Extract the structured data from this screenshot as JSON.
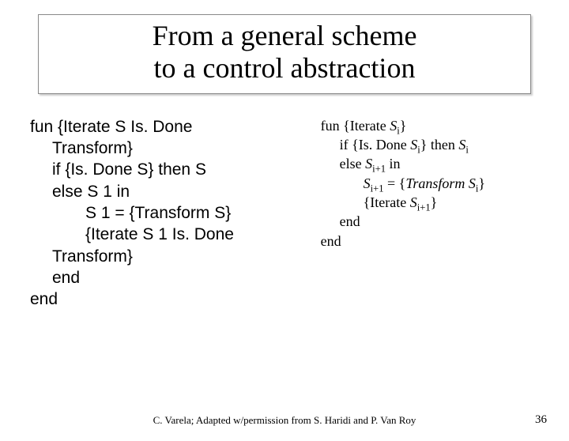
{
  "title_line1": "From a general scheme",
  "title_line2": "to a control abstraction",
  "left": {
    "l1": "fun {Iterate S Is. Done",
    "l2": "Transform}",
    "l3": "if {Is. Done S} then S",
    "l4": "else S 1 in",
    "l5": "S 1 = {Transform S}",
    "l6": "{Iterate S 1 Is. Done",
    "l7": "Transform}",
    "l8": "end",
    "l9": "end"
  },
  "right": {
    "r1a": "fun {Iterate ",
    "r1b": "S",
    "r1c": "i",
    "r1d": "}",
    "r2a": "if {Is. Done ",
    "r2b": "S",
    "r2c": "i",
    "r2d": "} then ",
    "r2e": "S",
    "r2f": "i",
    "r3a": "else ",
    "r3b": "S",
    "r3c": "i+1",
    "r3d": " in",
    "r4a": "S",
    "r4b": "i+1",
    "r4c": " = {",
    "r4d": "Transform ",
    "r4e": "S",
    "r4f": "i",
    "r4g": "}",
    "r5a": "{Iterate ",
    "r5b": "S",
    "r5c": "i+1",
    "r5d": "}",
    "r6": "end",
    "r7": "end"
  },
  "footer": {
    "credit": "C. Varela; Adapted w/permission from S. Haridi and P. Van Roy",
    "page": "36"
  }
}
